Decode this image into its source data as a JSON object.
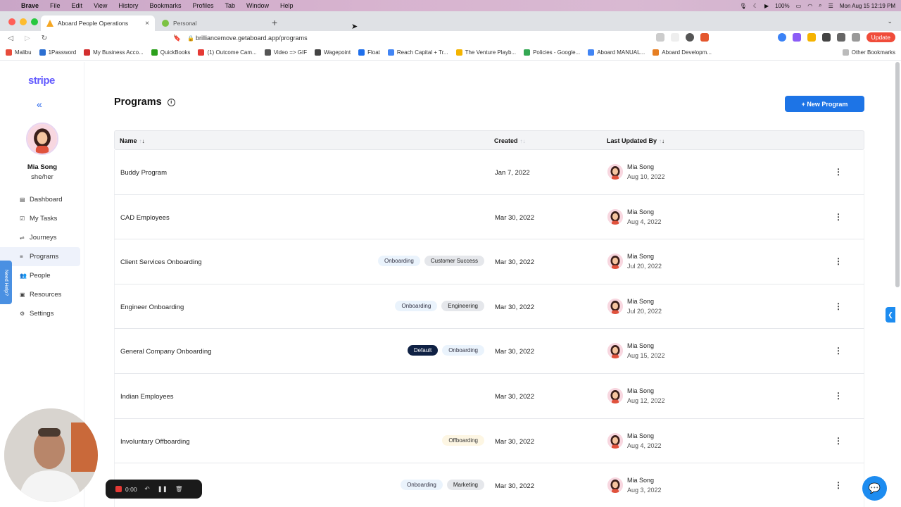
{
  "menubar": {
    "app": "Brave",
    "items": [
      "File",
      "Edit",
      "View",
      "History",
      "Bookmarks",
      "Profiles",
      "Tab",
      "Window",
      "Help"
    ],
    "battery": "100%",
    "clock": "Mon Aug 15  12:19 PM"
  },
  "tabs": [
    {
      "title": "Aboard People Operations",
      "close": "×"
    },
    {
      "title": "Personal"
    }
  ],
  "browser": {
    "url": "brilliancemove.getaboard.app/programs",
    "update_label": "Update",
    "new_tab": "+"
  },
  "bookmarks": [
    {
      "label": "Malibu",
      "color": "#e74c3c"
    },
    {
      "label": "1Password",
      "color": "#2c6fd1"
    },
    {
      "label": "My Business Acco...",
      "color": "#d32f2f"
    },
    {
      "label": "QuickBooks",
      "color": "#2ca01c"
    },
    {
      "label": "(1) Outcome Cam...",
      "color": "#e53935"
    },
    {
      "label": "Video => GIF",
      "color": "#555555"
    },
    {
      "label": "Wagepoint",
      "color": "#444444"
    },
    {
      "label": "Float",
      "color": "#1f6feb"
    },
    {
      "label": "Reach Capital + Tr...",
      "color": "#4285f4"
    },
    {
      "label": "The Venture Playb...",
      "color": "#f4b400"
    },
    {
      "label": "Policies - Google...",
      "color": "#34a853"
    },
    {
      "label": "Aboard MANUAL...",
      "color": "#4285f4"
    },
    {
      "label": "Aboard Developm...",
      "color": "#e67e22"
    }
  ],
  "other_bookmarks": "Other Bookmarks",
  "sidebar": {
    "logo": "stripe",
    "collapse": "«",
    "user_name": "Mia Song",
    "pronouns": "she/her",
    "items": [
      {
        "label": "Dashboard",
        "icon": "▤"
      },
      {
        "label": "My Tasks",
        "icon": "☑"
      },
      {
        "label": "Journeys",
        "icon": "⇌"
      },
      {
        "label": "Programs",
        "icon": "≡",
        "active": true
      },
      {
        "label": "People",
        "icon": "👥"
      },
      {
        "label": "Resources",
        "icon": "▣"
      },
      {
        "label": "Settings",
        "icon": "⚙"
      }
    ],
    "need_help": "Need Help?"
  },
  "page": {
    "title": "Programs",
    "new_button": "+ New Program"
  },
  "table": {
    "headers": {
      "name": "Name",
      "created": "Created",
      "updated": "Last Updated By"
    },
    "rows": [
      {
        "name": "Buddy Program",
        "tags": [],
        "created": "Jan 7, 2022",
        "user": "Mia Song",
        "updated": "Aug 10, 2022"
      },
      {
        "name": "CAD Employees",
        "tags": [],
        "created": "Mar 30, 2022",
        "user": "Mia Song",
        "updated": "Aug 4, 2022"
      },
      {
        "name": "Client Services Onboarding",
        "tags": [
          {
            "label": "Onboarding",
            "style": "t-onboarding"
          },
          {
            "label": "Customer Success",
            "style": "t-gray"
          }
        ],
        "created": "Mar 30, 2022",
        "user": "Mia Song",
        "updated": "Jul 20, 2022"
      },
      {
        "name": "Engineer Onboarding",
        "tags": [
          {
            "label": "Onboarding",
            "style": "t-onboarding"
          },
          {
            "label": "Engineering",
            "style": "t-gray"
          }
        ],
        "created": "Mar 30, 2022",
        "user": "Mia Song",
        "updated": "Jul 20, 2022"
      },
      {
        "name": "General Company Onboarding",
        "tags": [
          {
            "label": "Default",
            "style": "t-default"
          },
          {
            "label": "Onboarding",
            "style": "t-onboarding"
          }
        ],
        "created": "Mar 30, 2022",
        "user": "Mia Song",
        "updated": "Aug 15, 2022"
      },
      {
        "name": "Indian Employees",
        "tags": [],
        "created": "Mar 30, 2022",
        "user": "Mia Song",
        "updated": "Aug 12, 2022"
      },
      {
        "name": "Involuntary Offboarding",
        "tags": [
          {
            "label": "Offboarding",
            "style": "t-off"
          }
        ],
        "created": "Mar 30, 2022",
        "user": "Mia Song",
        "updated": "Aug 4, 2022"
      },
      {
        "name": "",
        "tags": [
          {
            "label": "Onboarding",
            "style": "t-onboarding"
          },
          {
            "label": "Marketing",
            "style": "t-gray"
          }
        ],
        "created": "Mar 30, 2022",
        "user": "Mia Song",
        "updated": "Aug 3, 2022"
      }
    ]
  },
  "recorder": {
    "time": "0:00"
  }
}
